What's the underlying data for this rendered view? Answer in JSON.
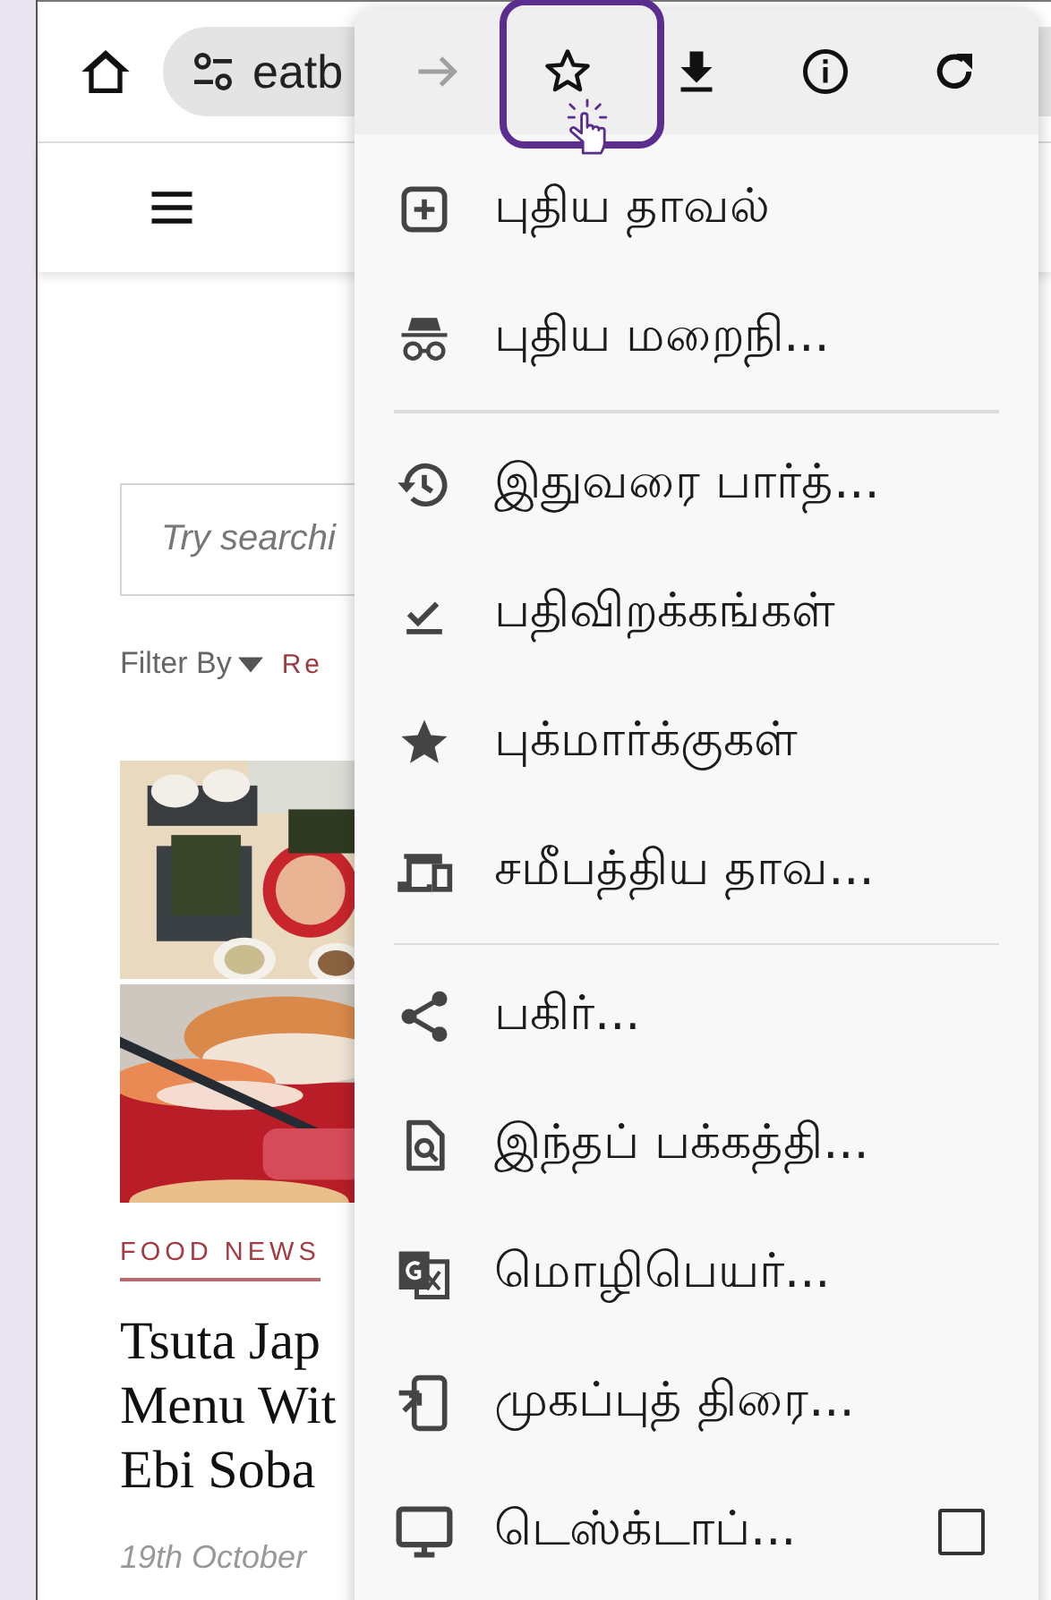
{
  "browser": {
    "address_bar": {
      "text": "eatb"
    }
  },
  "page": {
    "search": {
      "placeholder": "Try searchi"
    },
    "filter": {
      "label": "Filter By",
      "reset": "Re"
    },
    "article": {
      "category": "FOOD NEWS",
      "title_lines": [
        "Tsuta Jap",
        "Menu Wit",
        "Ebi Soba"
      ],
      "date": "19th October"
    }
  },
  "menu": {
    "actions": [
      {
        "kind": "forward",
        "disabled": true,
        "highlighted": false
      },
      {
        "kind": "bookmark",
        "disabled": false,
        "highlighted": true
      },
      {
        "kind": "download",
        "disabled": false,
        "highlighted": false
      },
      {
        "kind": "info",
        "disabled": false,
        "highlighted": false
      },
      {
        "kind": "reload",
        "disabled": false,
        "highlighted": false
      }
    ],
    "items": [
      {
        "kind": "item",
        "label": "புதிய தாவல்"
      },
      {
        "kind": "item",
        "label": "புதிய மறைநி..."
      },
      {
        "kind": "divider"
      },
      {
        "kind": "item",
        "label": "இதுவரை பார்த்..."
      },
      {
        "kind": "item",
        "label": "பதிவிறக்கங்கள்"
      },
      {
        "kind": "item",
        "label": "புக்மார்க்குகள்"
      },
      {
        "kind": "item",
        "label": "சமீபத்திய தாவ..."
      },
      {
        "kind": "divider"
      },
      {
        "kind": "item",
        "label": "பகிர்..."
      },
      {
        "kind": "item",
        "label": "இந்தப் பக்கத்தி..."
      },
      {
        "kind": "item",
        "label": "மொழிபெயர்..."
      },
      {
        "kind": "item",
        "label": "முகப்புத் திரை..."
      },
      {
        "kind": "checkbox",
        "label": "டெஸ்க்டாப்...",
        "checked": false
      }
    ]
  }
}
